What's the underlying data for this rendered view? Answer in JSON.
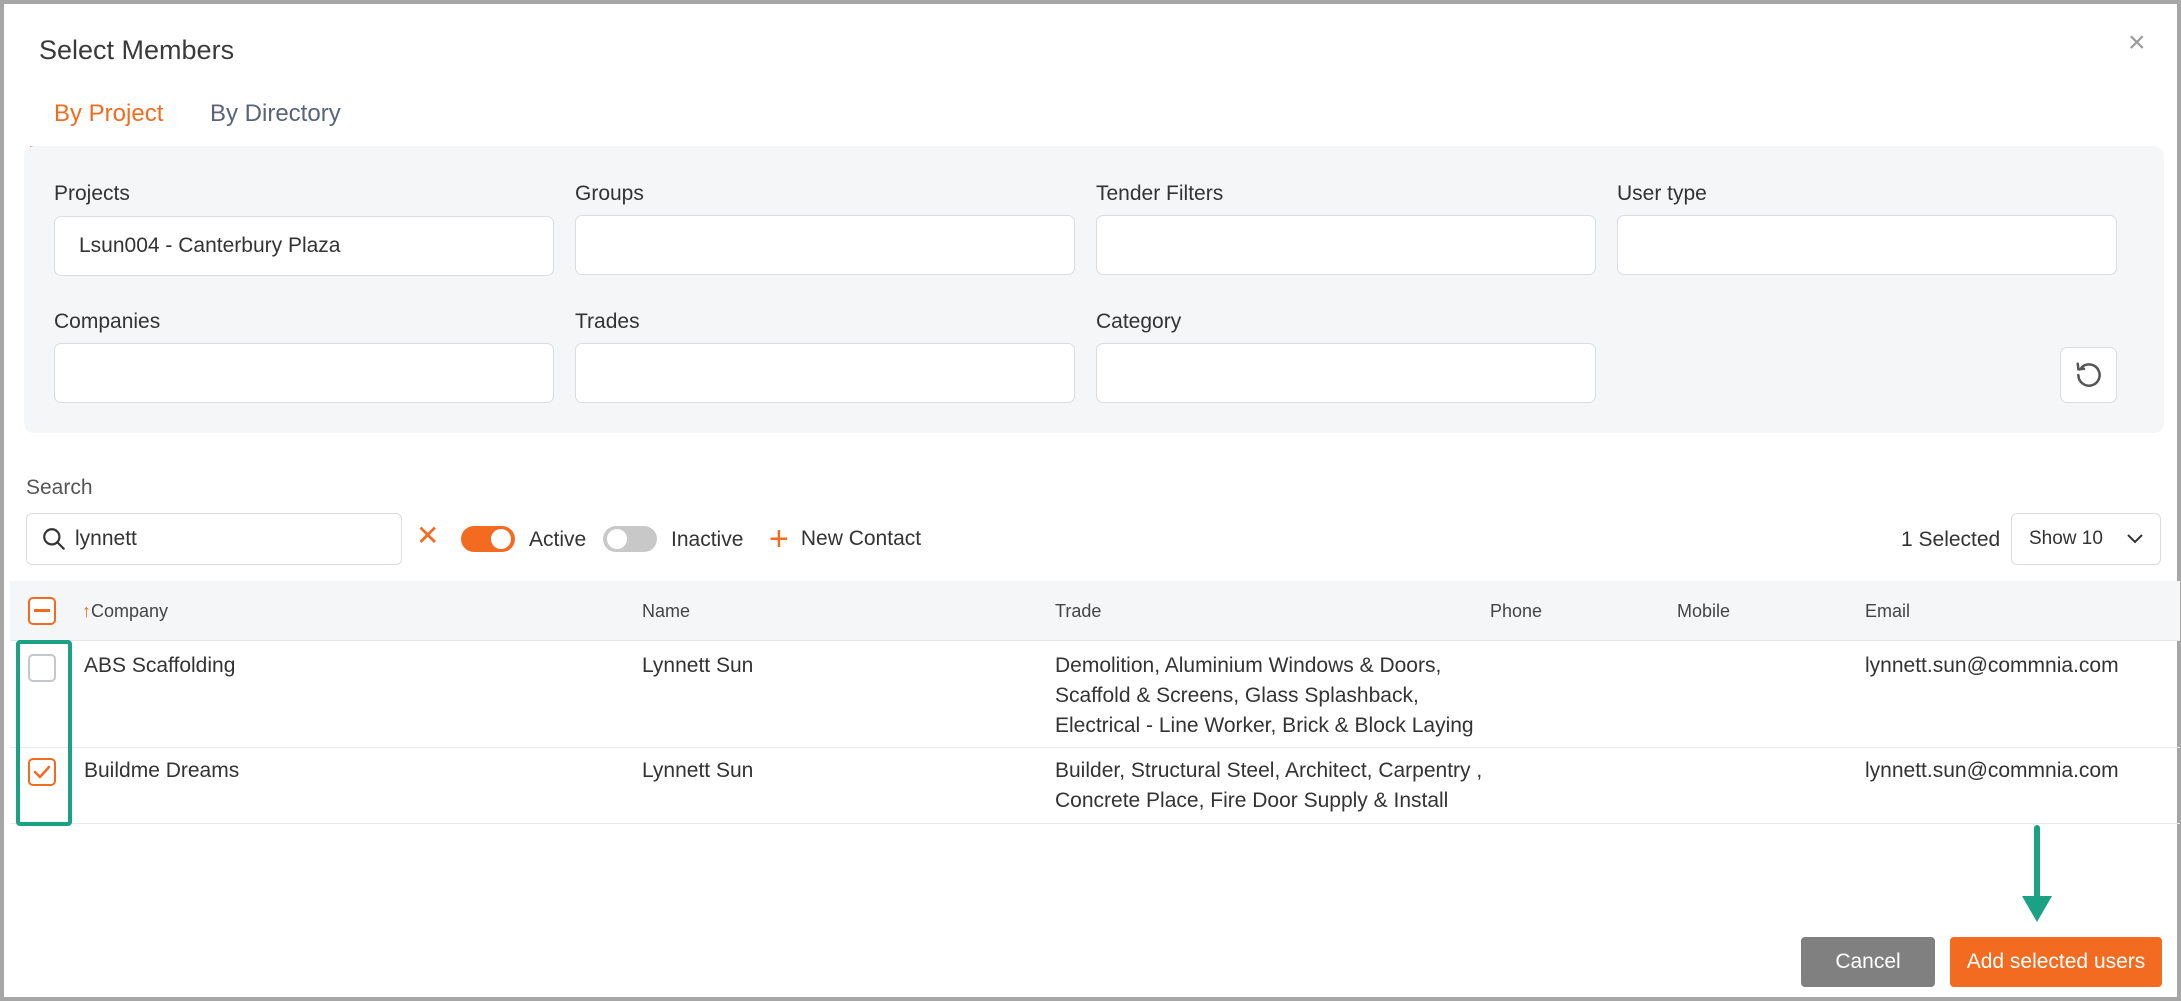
{
  "dialog": {
    "title": "Select Members"
  },
  "tabs": [
    {
      "label": "By Project",
      "active": true
    },
    {
      "label": "By Directory",
      "active": false
    }
  ],
  "filters": {
    "projects": {
      "label": "Projects",
      "value": "Lsun004 - Canterbury Plaza"
    },
    "groups": {
      "label": "Groups",
      "value": ""
    },
    "tender_filters": {
      "label": "Tender Filters",
      "value": ""
    },
    "user_type": {
      "label": "User type",
      "value": ""
    },
    "companies": {
      "label": "Companies",
      "value": ""
    },
    "trades": {
      "label": "Trades",
      "value": ""
    },
    "category": {
      "label": "Category",
      "value": ""
    }
  },
  "search": {
    "label": "Search",
    "value": "lynnett"
  },
  "toggles": {
    "active": {
      "label": "Active",
      "on": true
    },
    "inactive": {
      "label": "Inactive",
      "on": false
    }
  },
  "new_contact_label": "New Contact",
  "selected_count": "1 Selected",
  "page_size": "Show 10",
  "table": {
    "columns": {
      "company": "Company",
      "name": "Name",
      "trade": "Trade",
      "phone": "Phone",
      "mobile": "Mobile",
      "email": "Email"
    },
    "rows": [
      {
        "company": "ABS Scaffolding",
        "name": "Lynnett Sun",
        "trade_lines": [
          "Demolition, Aluminium Windows & Doors,",
          "Scaffold & Screens, Glass Splashback,",
          "Electrical - Line Worker, Brick & Block Laying"
        ],
        "phone": "",
        "mobile": "",
        "email": "lynnett.sun@commnia.com",
        "checked": false
      },
      {
        "company": "Buildme Dreams",
        "name": "Lynnett Sun",
        "trade_lines": [
          "Builder, Structural Steel, Architect, Carpentry ,",
          "Concrete Place, Fire Door Supply & Install"
        ],
        "phone": "",
        "mobile": "",
        "email": "lynnett.sun@commnia.com",
        "checked": true
      }
    ]
  },
  "footer": {
    "cancel_label": "Cancel",
    "add_label": "Add selected users"
  },
  "colors": {
    "accent": "#f26b21",
    "annotation": "#1ba184",
    "cancel": "#808080"
  },
  "icons": [
    "close-icon",
    "search-icon",
    "clear-icon",
    "plus-icon",
    "reset-icon",
    "chevron-down-icon",
    "sort-asc-icon",
    "check-icon",
    "minus-icon",
    "arrow-down-annotation-icon"
  ]
}
